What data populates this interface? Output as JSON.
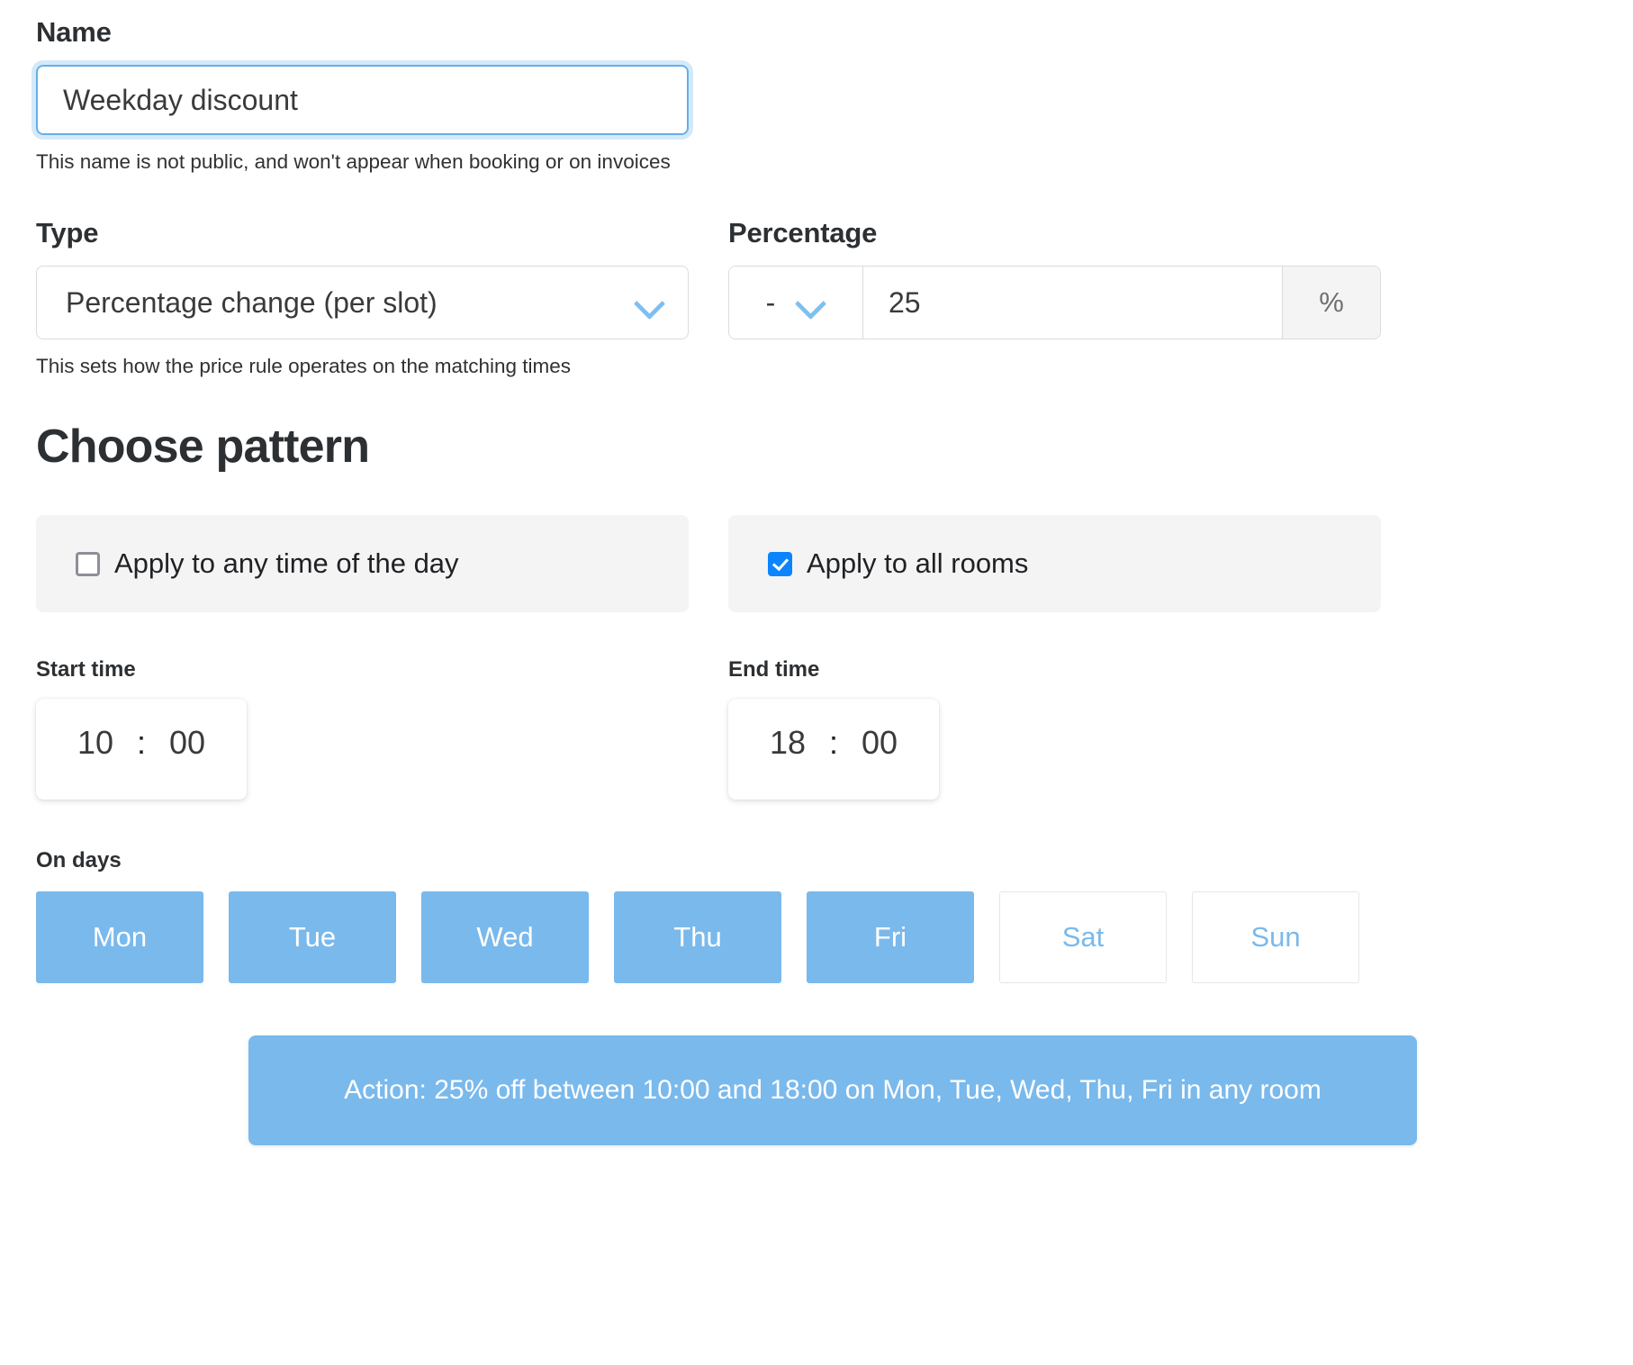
{
  "name_section": {
    "label": "Name",
    "value": "Weekday discount",
    "placeholder": "Name",
    "helper": "This name is not public, and won't appear when booking or on invoices"
  },
  "type_section": {
    "label": "Type",
    "selected": "Percentage change (per slot)",
    "helper": "This sets how the price rule operates on the matching times",
    "chevron_icon": "chevron-down-icon"
  },
  "percentage_section": {
    "label": "Percentage",
    "sign": "-",
    "value": "25",
    "placeholder": "0",
    "suffix": "%",
    "chevron_icon": "chevron-down-icon"
  },
  "pattern_section": {
    "heading": "Choose pattern",
    "any_time_checkbox": {
      "label": "Apply to any time of the day",
      "checked": false
    },
    "all_rooms_checkbox": {
      "label": "Apply to all rooms",
      "checked": true
    },
    "start_time": {
      "label": "Start time",
      "hour": "10",
      "separator": ":",
      "minute": "00"
    },
    "end_time": {
      "label": "End time",
      "hour": "18",
      "separator": ":",
      "minute": "00"
    },
    "on_days_label": "On days",
    "days": [
      {
        "label": "Mon",
        "selected": true
      },
      {
        "label": "Tue",
        "selected": true
      },
      {
        "label": "Wed",
        "selected": true
      },
      {
        "label": "Thu",
        "selected": true
      },
      {
        "label": "Fri",
        "selected": true
      },
      {
        "label": "Sat",
        "selected": false
      },
      {
        "label": "Sun",
        "selected": false
      }
    ]
  },
  "action_banner": {
    "text": "Action: 25% off between 10:00 and 18:00 on Mon, Tue, Wed, Thu, Fri in any room"
  },
  "colors": {
    "accent_blue": "#7ab9ec",
    "checkbox_blue": "#0b84ff",
    "focus_blue": "#66afe9",
    "panel_gray": "#f4f4f4",
    "border_gray": "#dcdcdc"
  }
}
